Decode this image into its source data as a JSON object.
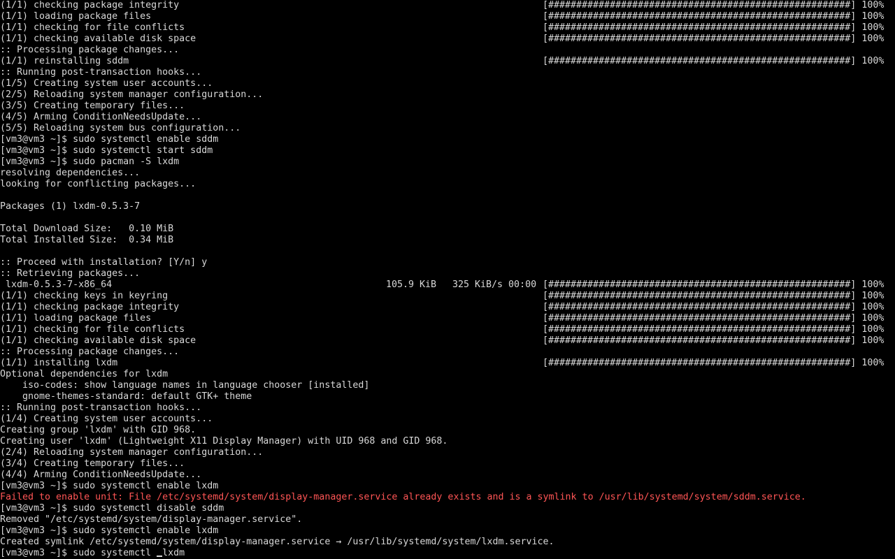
{
  "terminal": {
    "bar_fill": "######################################################",
    "lines": [
      {
        "text": "(1/1) checking package integrity",
        "progress": 100,
        "bar": "[######################################################] 100%"
      },
      {
        "text": "(1/1) loading package files",
        "progress": 100,
        "bar": "[######################################################] 100%"
      },
      {
        "text": "(1/1) checking for file conflicts",
        "progress": 100,
        "bar": "[######################################################] 100%"
      },
      {
        "text": "(1/1) checking available disk space",
        "progress": 100,
        "bar": "[######################################################] 100%"
      },
      {
        "text": ":: Processing package changes..."
      },
      {
        "text": "(1/1) reinstalling sddm",
        "progress": 100,
        "bar": "[######################################################] 100%"
      },
      {
        "text": ":: Running post-transaction hooks..."
      },
      {
        "text": "(1/5) Creating system user accounts..."
      },
      {
        "text": "(2/5) Reloading system manager configuration..."
      },
      {
        "text": "(3/5) Creating temporary files..."
      },
      {
        "text": "(4/5) Arming ConditionNeedsUpdate..."
      },
      {
        "text": "(5/5) Reloading system bus configuration..."
      },
      {
        "text": "[vm3@vm3 ~]$ sudo systemctl enable sddm"
      },
      {
        "text": "[vm3@vm3 ~]$ sudo systemctl start sddm"
      },
      {
        "text": "[vm3@vm3 ~]$ sudo pacman -S lxdm"
      },
      {
        "text": "resolving dependencies..."
      },
      {
        "text": "looking for conflicting packages..."
      },
      {
        "text": ""
      },
      {
        "text": "Packages (1) lxdm-0.5.3-7"
      },
      {
        "text": ""
      },
      {
        "text": "Total Download Size:   0.10 MiB"
      },
      {
        "text": "Total Installed Size:  0.34 MiB"
      },
      {
        "text": ""
      },
      {
        "text": ":: Proceed with installation? [Y/n] y"
      },
      {
        "text": ":: Retrieving packages..."
      },
      {
        "text": " lxdm-0.5.3-7-x86_64",
        "size": "105.9 KiB",
        "rate": "325 KiB/s 00:00",
        "progress": 100,
        "bar": "[######################################################] 100%"
      },
      {
        "text": "(1/1) checking keys in keyring",
        "progress": 100,
        "bar": "[######################################################] 100%"
      },
      {
        "text": "(1/1) checking package integrity",
        "progress": 100,
        "bar": "[######################################################] 100%"
      },
      {
        "text": "(1/1) loading package files",
        "progress": 100,
        "bar": "[######################################################] 100%"
      },
      {
        "text": "(1/1) checking for file conflicts",
        "progress": 100,
        "bar": "[######################################################] 100%"
      },
      {
        "text": "(1/1) checking available disk space",
        "progress": 100,
        "bar": "[######################################################] 100%"
      },
      {
        "text": ":: Processing package changes..."
      },
      {
        "text": "(1/1) installing lxdm",
        "progress": 100,
        "bar": "[######################################################] 100%"
      },
      {
        "text": "Optional dependencies for lxdm"
      },
      {
        "text": "    iso-codes: show language names in language chooser [installed]"
      },
      {
        "text": "    gnome-themes-standard: default GTK+ theme"
      },
      {
        "text": ":: Running post-transaction hooks..."
      },
      {
        "text": "(1/4) Creating system user accounts..."
      },
      {
        "text": "Creating group 'lxdm' with GID 968."
      },
      {
        "text": "Creating user 'lxdm' (Lightweight X11 Display Manager) with UID 968 and GID 968."
      },
      {
        "text": "(2/4) Reloading system manager configuration..."
      },
      {
        "text": "(3/4) Creating temporary files..."
      },
      {
        "text": "(4/4) Arming ConditionNeedsUpdate..."
      },
      {
        "text": "[vm3@vm3 ~]$ sudo systemctl enable lxdm"
      },
      {
        "text": "Failed to enable unit: File /etc/systemd/system/display-manager.service already exists and is a symlink to /usr/lib/systemd/system/sddm.service.",
        "error": true
      },
      {
        "text": "[vm3@vm3 ~]$ sudo systemctl disable sddm"
      },
      {
        "text": "Removed \"/etc/systemd/system/display-manager.service\"."
      },
      {
        "text": "[vm3@vm3 ~]$ sudo systemctl enable lxdm"
      },
      {
        "text": "Created symlink /etc/systemd/system/display-manager.service → /usr/lib/systemd/system/lxdm.service."
      }
    ],
    "prompt": {
      "text": "[vm3@vm3 ~]$ sudo systemctl ",
      "after_cursor": "lxdm"
    },
    "colors": {
      "background": "#000000",
      "foreground": "#d8d8d8",
      "error": "#ff5555"
    }
  }
}
